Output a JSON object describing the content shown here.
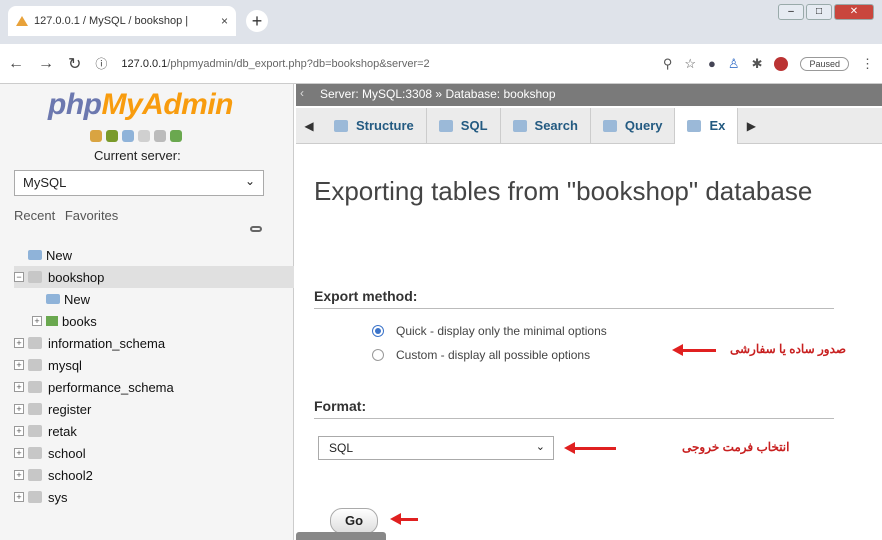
{
  "browser": {
    "tab_title": "127.0.0.1 / MySQL / bookshop |",
    "close_glyph": "×",
    "new_tab_glyph": "+",
    "url_host": "127.0.0.1",
    "url_path": "/phpmyadmin/db_export.php?db=bookshop&server=2",
    "paused_label": "Paused"
  },
  "sidebar": {
    "logo_php": "php",
    "logo_my": "MyAdmin",
    "current_server_label": "Current server:",
    "server_value": "MySQL",
    "recent_label": "Recent",
    "favorites_label": "Favorites",
    "tree": [
      {
        "label": "New",
        "kind": "new",
        "indent": 0
      },
      {
        "label": "bookshop",
        "kind": "db",
        "indent": 0,
        "expanded": true,
        "selected": true
      },
      {
        "label": "New",
        "kind": "new",
        "indent": 1
      },
      {
        "label": "books",
        "kind": "table",
        "indent": 1
      },
      {
        "label": "information_schema",
        "kind": "db",
        "indent": 0
      },
      {
        "label": "mysql",
        "kind": "db",
        "indent": 0
      },
      {
        "label": "performance_schema",
        "kind": "db",
        "indent": 0
      },
      {
        "label": "register",
        "kind": "db",
        "indent": 0
      },
      {
        "label": "retak",
        "kind": "db",
        "indent": 0
      },
      {
        "label": "school",
        "kind": "db",
        "indent": 0
      },
      {
        "label": "school2",
        "kind": "db",
        "indent": 0
      },
      {
        "label": "sys",
        "kind": "db",
        "indent": 0
      }
    ]
  },
  "main": {
    "breadcrumb_server": "Server: MySQL:3308",
    "breadcrumb_sep": "»",
    "breadcrumb_db": "Database: bookshop",
    "tabs": [
      {
        "label": "Structure"
      },
      {
        "label": "SQL"
      },
      {
        "label": "Search"
      },
      {
        "label": "Query"
      },
      {
        "label": "Ex"
      }
    ],
    "heading": "Exporting tables from \"bookshop\" database",
    "export_method_label": "Export method:",
    "quick_option": "Quick - display only the minimal options",
    "custom_option": "Custom - display all possible options",
    "format_label": "Format:",
    "format_value": "SQL",
    "go_label": "Go"
  },
  "annotations": {
    "method_note": "صدور ساده یا سفارشی",
    "format_note": "انتخاب فرمت خروجی"
  },
  "colors": {
    "accent": "#3b73c9",
    "logo_php": "#6c78af",
    "logo_myadmin": "#f89c0e",
    "annotation": "#e02020"
  }
}
